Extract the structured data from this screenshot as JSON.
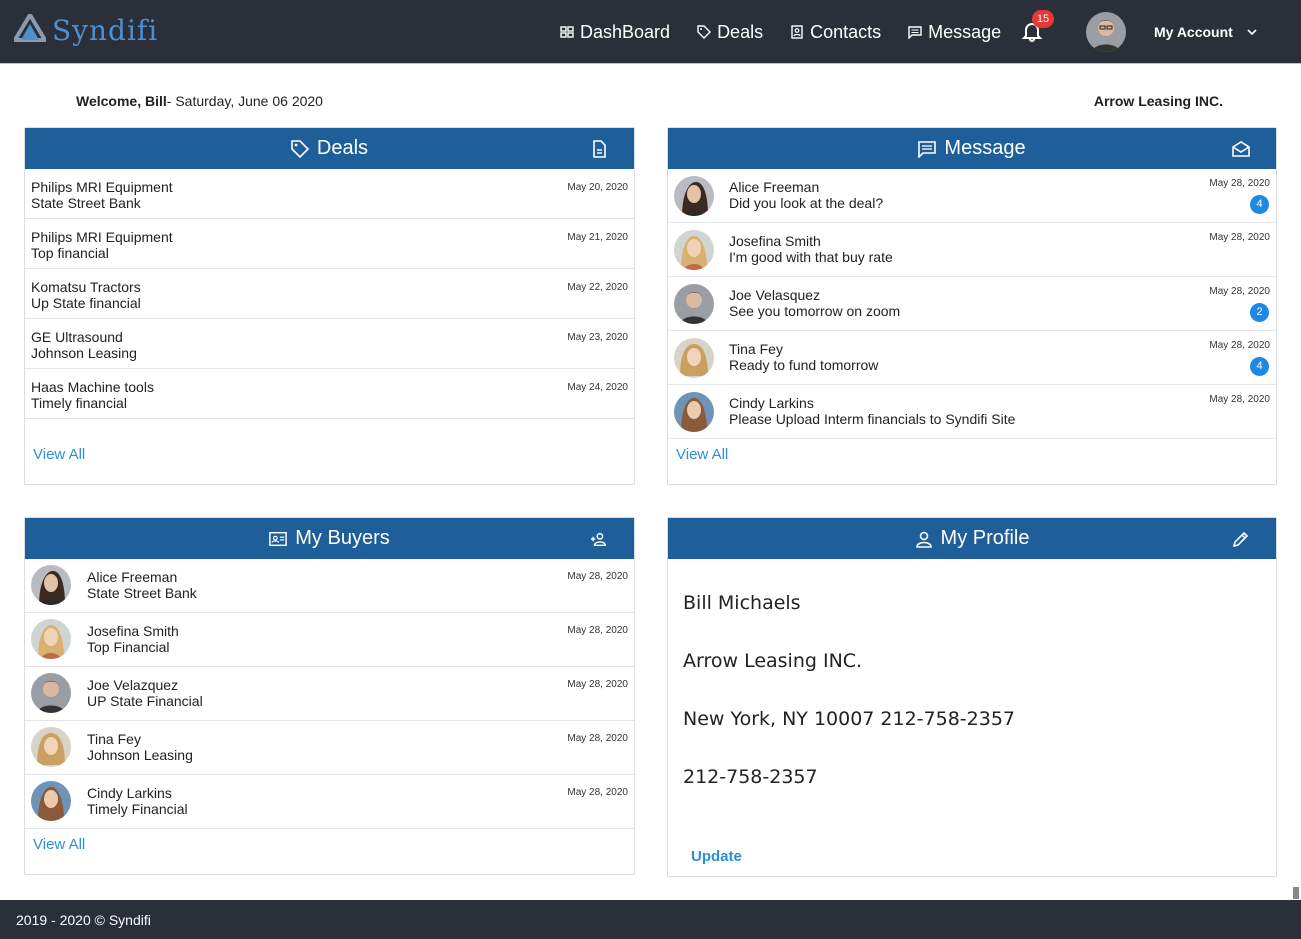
{
  "brand": {
    "name": "Syndifi"
  },
  "nav": {
    "items": [
      {
        "label": "DashBoard",
        "icon": "dashboard-icon"
      },
      {
        "label": "Deals",
        "icon": "tag-icon"
      },
      {
        "label": "Contacts",
        "icon": "contacts-icon"
      },
      {
        "label": "Message",
        "icon": "message-icon"
      }
    ],
    "notifications": "15",
    "account_label": "My Account"
  },
  "welcome": {
    "greeting": "Welcome, Bill",
    "date": "- Saturday, June 06 2020",
    "company": "Arrow Leasing INC."
  },
  "deals": {
    "title": "Deals",
    "view_all": "View All",
    "items": [
      {
        "name": "Philips MRI Equipment",
        "bank": "State Street Bank",
        "date": "May 20, 2020"
      },
      {
        "name": "Philips MRI Equipment",
        "bank": "Top financial",
        "date": "May 21, 2020"
      },
      {
        "name": "Komatsu Tractors",
        "bank": "Up State financial",
        "date": "May 22, 2020"
      },
      {
        "name": "GE Ultrasound",
        "bank": "Johnson Leasing",
        "date": "May 23, 2020"
      },
      {
        "name": "Haas Machine tools",
        "bank": "Timely financial",
        "date": "May 24, 2020"
      }
    ]
  },
  "messages": {
    "title": "Message",
    "view_all": "View All",
    "items": [
      {
        "name": "Alice Freeman",
        "text": "Did you look at the deal?",
        "date": "May 28, 2020",
        "count": "4"
      },
      {
        "name": "Josefina Smith",
        "text": "I'm good with that buy rate",
        "date": "May 28, 2020",
        "count": ""
      },
      {
        "name": "Joe Velasquez",
        "text": "See you tomorrow on zoom",
        "date": "May 28, 2020",
        "count": "2"
      },
      {
        "name": "Tina Fey",
        "text": "Ready to fund tomorrow",
        "date": "May 28, 2020",
        "count": "4"
      },
      {
        "name": "Cindy Larkins",
        "text": "Please Upload Interm financials to Syndifi Site",
        "date": "May 28, 2020",
        "count": ""
      }
    ]
  },
  "buyers": {
    "title": "My Buyers",
    "view_all": "View All",
    "items": [
      {
        "name": "Alice Freeman",
        "company": "State Street Bank",
        "date": "May 28, 2020"
      },
      {
        "name": "Josefina Smith",
        "company": "Top Financial",
        "date": "May 28, 2020"
      },
      {
        "name": "Joe Velazquez",
        "company": "UP State Financial",
        "date": "May 28, 2020"
      },
      {
        "name": "Tina Fey",
        "company": "Johnson Leasing",
        "date": "May 28, 2020"
      },
      {
        "name": "Cindy Larkins",
        "company": "Timely Financial",
        "date": "May 28, 2020"
      }
    ]
  },
  "profile": {
    "title": "My Profile",
    "name": "Bill Michaels",
    "company": "Arrow Leasing INC.",
    "address": "New York, NY 10007 212-758-2357",
    "phone": "212-758-2357",
    "update": "Update"
  },
  "footer": {
    "text": "2019 - 2020 © Syndifi"
  },
  "colors": {
    "navbar": "#2b2f3a",
    "header": "#1e5f99",
    "link": "#2b8fd6",
    "badge": "#e53935",
    "count": "#1e88e5"
  }
}
